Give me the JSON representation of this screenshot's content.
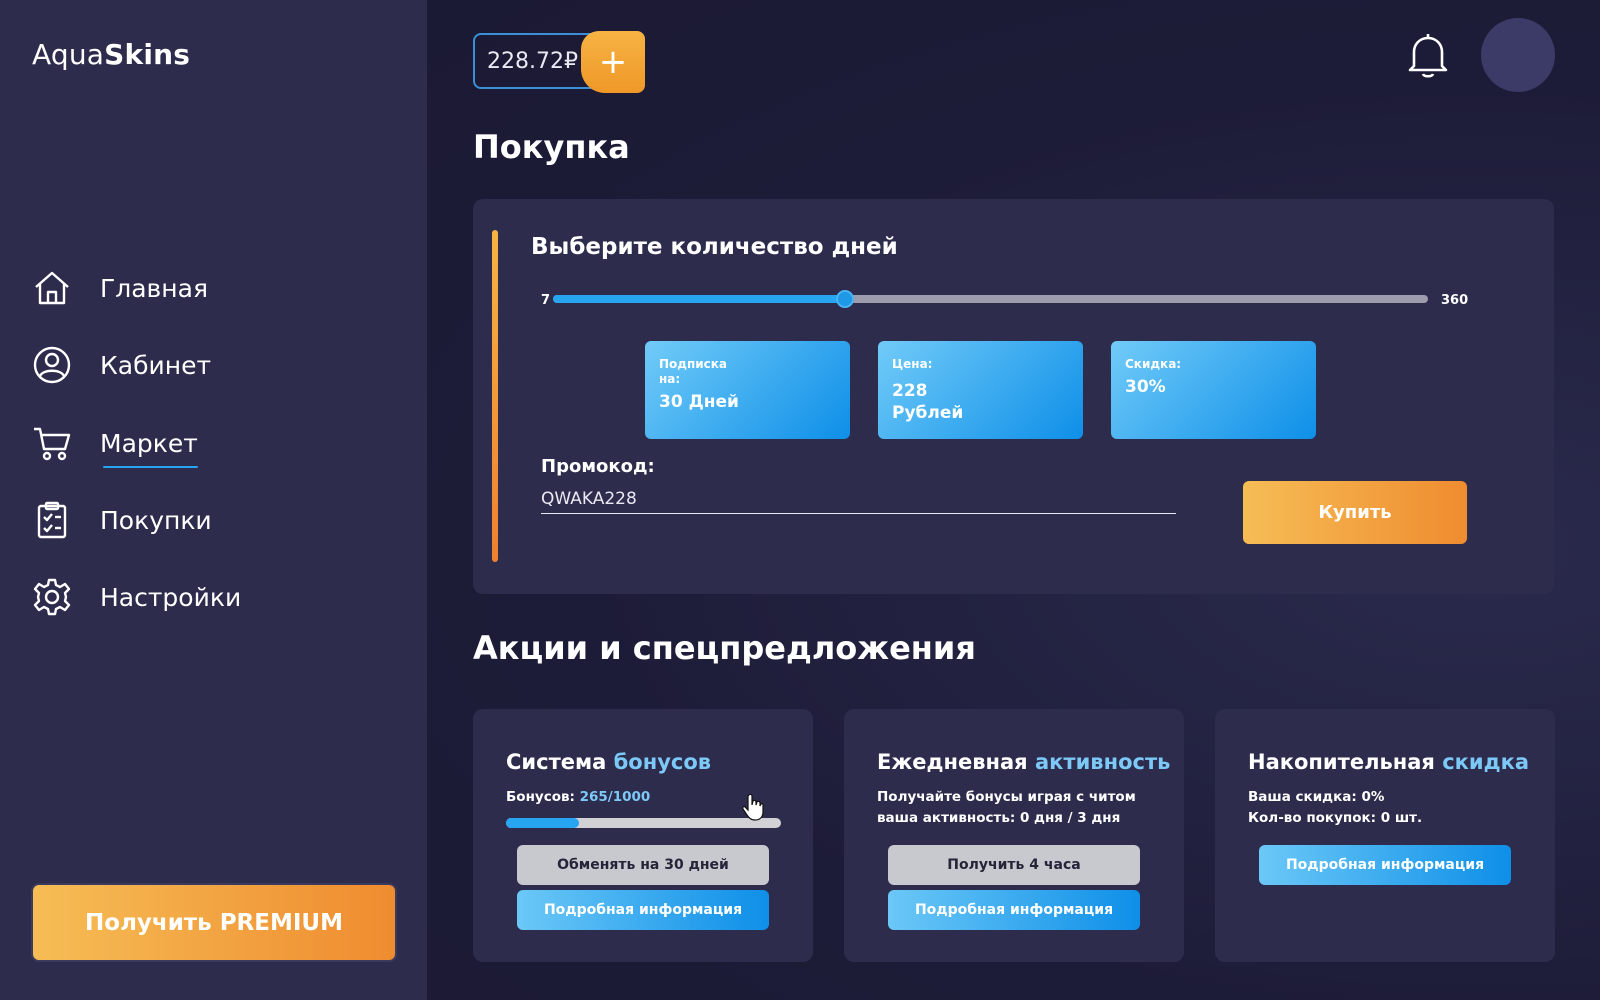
{
  "brand": {
    "prefix": "Aqua",
    "bold": "Skins"
  },
  "sidebar": {
    "items": [
      {
        "label": "Главная",
        "icon": "home-icon"
      },
      {
        "label": "Кабинет",
        "icon": "user-icon"
      },
      {
        "label": "Маркет",
        "icon": "cart-icon",
        "active": true
      },
      {
        "label": "Покупки",
        "icon": "clipboard-icon"
      },
      {
        "label": "Настройки",
        "icon": "gear-icon"
      }
    ],
    "premium_label": "Получить PREMIUM"
  },
  "header": {
    "balance": "228.72₽",
    "add_label": "+",
    "bell_icon": "bell-icon",
    "avatar": "avatar"
  },
  "purchase": {
    "title": "Покупка",
    "days_title": "Выберите количество дней",
    "slider": {
      "min": "7",
      "max": "360",
      "value": 125
    },
    "tiles": [
      {
        "label": "Подписка на:",
        "value": "30 Дней"
      },
      {
        "label": "Цена:",
        "value": "228 Рублей"
      },
      {
        "label": "Скидка:",
        "value": "30%"
      }
    ],
    "promo_label": "Промокод:",
    "promo_value": "QWAKA228",
    "buy_label": "Купить"
  },
  "promotions": {
    "title": "Акции и спецпредложения",
    "cards": [
      {
        "title_plain": "Система",
        "title_highlight": "бонусов",
        "bonus_label": "Бонусов:",
        "bonus_value": "265/1000",
        "bonus_progress": 0.265,
        "primary_btn": "Обменять на 30 дней",
        "info_btn": "Подробная информация"
      },
      {
        "title_plain": "Ежедневная",
        "title_highlight": "активность",
        "line1": "Получайте бонусы играя с читом",
        "line2": "ваша активность: 0 дня / 3 дня",
        "primary_btn": "Получить 4 часа",
        "info_btn": "Подробная информация"
      },
      {
        "title_plain": "Накопительная",
        "title_highlight": "скидка",
        "line1": "Ваша скидка: 0%",
        "line2": "Кол-во покупок: 0 шт.",
        "info_btn": "Подробная информация"
      }
    ]
  },
  "colors": {
    "accent_blue": "#27a5f0",
    "accent_orange": "#ef8c30",
    "sidebar_bg": "#2d2c4d",
    "main_bg": "#1f1f3a"
  }
}
